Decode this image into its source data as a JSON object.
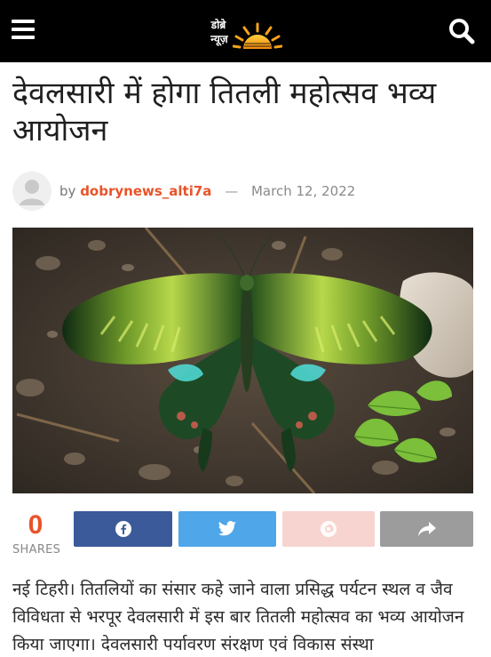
{
  "header": {
    "logo_line1": "डोब्रे",
    "logo_line2": "न्यूज़",
    "brand_color": "#f6a31b"
  },
  "article": {
    "title": "देवलसारी में होगा तितली महोत्सव भव्य आयोजन",
    "byline_prefix": "by",
    "author": "dobrynews_alti7a",
    "separator": "—",
    "date": "March 12, 2022",
    "body": "नई टिहरी। तितलियों का संसार कहे जाने वाला प्रसिद्ध पर्यटन स्थल व जैव विविधता से भरपूर देवलसारी में इस बार तितली महोत्सव का भव्य आयोजन किया जाएगा। देवलसारी पर्यावरण संरक्षण एवं विकास संस्था"
  },
  "share": {
    "count": "0",
    "label": "SHARES",
    "buttons": [
      "facebook-icon",
      "twitter-icon",
      "email-icon",
      "share-arrow-icon"
    ],
    "colors": {
      "facebook": "#3b5a9a",
      "twitter": "#4fa6e8",
      "email": "#f7d4d0",
      "more": "#9c9c9c"
    }
  },
  "colors": {
    "accent": "#e8542a",
    "topbar": "#000000"
  }
}
